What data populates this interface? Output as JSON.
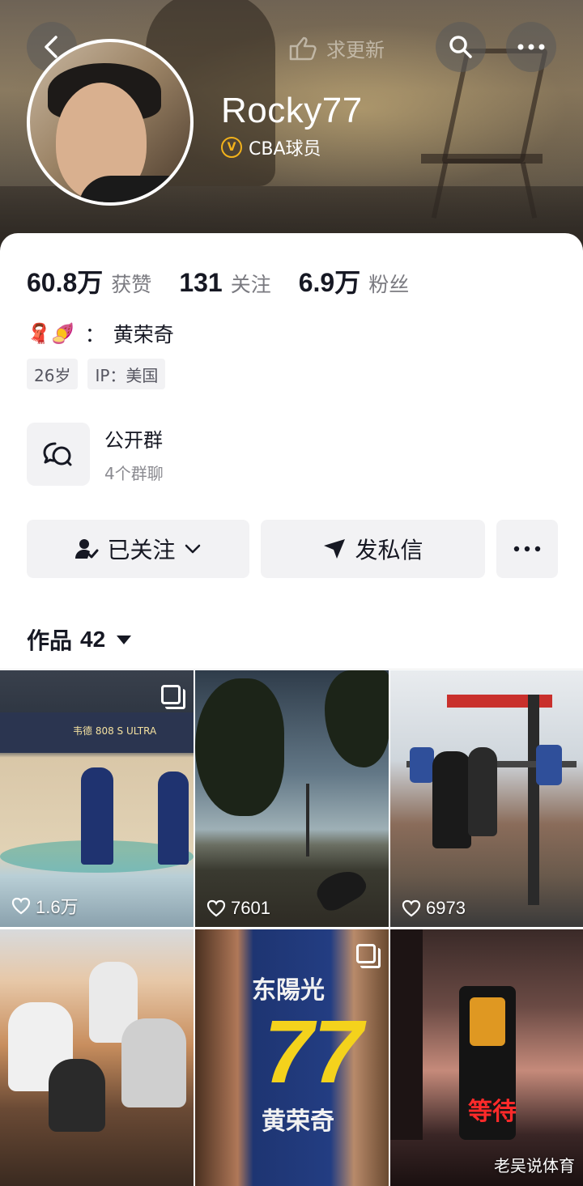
{
  "header": {
    "ask_update_label": "求更新",
    "nickname": "Rocky77",
    "verification": "CBA球员",
    "verification_badge": "V"
  },
  "stats": [
    {
      "value": "60.8万",
      "label": "获赞"
    },
    {
      "value": "131",
      "label": "关注"
    },
    {
      "value": "6.9万",
      "label": "粉丝"
    }
  ],
  "bio": {
    "emoji": "🧣🍠",
    "separator": "：",
    "text": "黄荣奇"
  },
  "tags": [
    "26岁",
    "IP：美国"
  ],
  "group": {
    "title": "公开群",
    "subtitle": "4个群聊"
  },
  "actions": {
    "followed_label": "已关注",
    "message_label": "发私信"
  },
  "works_tab": {
    "label": "作品",
    "count": "42"
  },
  "grid": [
    {
      "likes": "1.6万",
      "multi_image": true
    },
    {
      "likes": "7601",
      "multi_image": false
    },
    {
      "likes": "6973",
      "multi_image": false
    },
    {
      "likes": "",
      "multi_image": false
    },
    {
      "likes": "",
      "multi_image": true
    },
    {
      "likes": "",
      "multi_image": false
    }
  ],
  "thumbnail_text": {
    "ad_text": "韦德 808 S ULTRA",
    "jersey_team": "东陽光",
    "jersey_number": "77",
    "jersey_name": "黄荣奇",
    "traffic_text": "等待"
  },
  "watermark": "老吴说体育",
  "colors": {
    "accent_gold": "#f2b21b",
    "button_bg": "#f2f2f4",
    "text_primary": "#161823",
    "text_secondary": "#7a7a80"
  },
  "icons": [
    "chevron-left-icon",
    "thumb-update-icon",
    "search-icon",
    "more-dots-icon",
    "chat-bubbles-icon",
    "user-check-icon",
    "chevron-down-icon",
    "send-icon",
    "heart-icon",
    "multi-image-icon"
  ]
}
